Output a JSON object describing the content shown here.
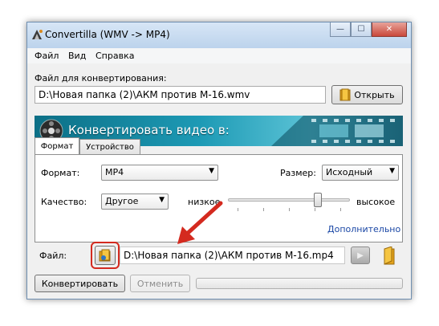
{
  "window": {
    "title": "Convertilla  (WMV -> MP4)",
    "controls": {
      "minimize": "—",
      "maximize": "☐",
      "close": "✕"
    }
  },
  "menu": {
    "items": [
      "Файл",
      "Вид",
      "Справка"
    ]
  },
  "source": {
    "label": "Файл для конвертирования:",
    "path": "D:\\Новая папка (2)\\АКМ против М-16.wmv",
    "open_button": "Открыть"
  },
  "banner": {
    "text": "Конвертировать видео в:"
  },
  "tabs": [
    "Формат",
    "Устройство"
  ],
  "format_tab": {
    "format_label": "Формат:",
    "format_value": "MP4",
    "size_label": "Размер:",
    "size_value": "Исходный",
    "quality_label": "Качество:",
    "quality_value": "Другое",
    "low_label": "низкое",
    "high_label": "высокое",
    "quality_level": 0.75,
    "advanced_link": "Дополнительно"
  },
  "output": {
    "label": "Файл:",
    "path": "D:\\Новая папка (2)\\АКМ против М-16.mp4"
  },
  "actions": {
    "convert": "Конвертировать",
    "cancel": "Отменить",
    "progress": 0
  },
  "colors": {
    "highlight": "#d42a1f",
    "banner": "#1d9ab5",
    "link": "#1a47a5"
  }
}
